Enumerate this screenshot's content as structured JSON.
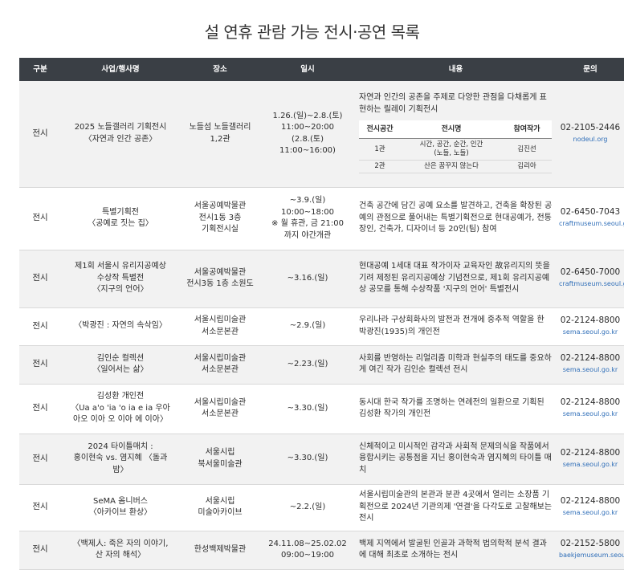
{
  "title": "설 연휴 관람 가능 전시·공연 목록",
  "headers": [
    "구분",
    "사업/행사명",
    "장소",
    "일시",
    "내용",
    "문의"
  ],
  "rows": [
    {
      "type": "전시",
      "name": [
        "2025 노들갤러리 기획전시",
        "〈자연과 인간 공존〉"
      ],
      "place": [
        "노들섬 노들갤러리",
        "1,2관"
      ],
      "date": [
        "1.26.(일)~2.8.(토)",
        "11:00~20:00",
        "(2.8.(토) 11:00~16:00)"
      ],
      "desc": "자연과 인간의 공존을 주제로 다양한 관점을 다채롭게 표현하는 릴레이 기획전시",
      "phone": "02-2105-2446",
      "site": "nodeul.org"
    },
    {
      "type": "전시",
      "name": [
        "특별기획전",
        "〈공예로 짓는 집〉"
      ],
      "place": [
        "서울공예박물관",
        "전시1동 3층",
        "기획전시실"
      ],
      "date": [
        "~3.9.(일)",
        "10:00~18:00",
        "※ 월 휴관, 금 21:00",
        "까지 야간개관"
      ],
      "desc": "건축 공간에 담긴 공예 요소를 발견하고, 건축을 확장된 공예의 관점으로 풀어내는 특별기획전으로 현대공예가, 전통 장인, 건축가, 디자이너 등 20인(팀) 참여",
      "phone": "02-6450-7043",
      "site": "craftmuseum.seoul.go.kr"
    },
    {
      "type": "전시",
      "name": [
        "제1회 서울시 유리지공예상",
        "수상작 특별전",
        "〈지구의 언어〉"
      ],
      "place": [
        "서울공예박물관",
        "전시3동 1층 소원도"
      ],
      "date": [
        "~3.16.(일)"
      ],
      "desc": "현대공예 1세대 대표 작가이자 교육자인 故유리지의 뜻을 기려 제정된 유리지공예상 기념전으로, 제1회 유리지공예상 공모를 통해 수상작품 '지구의 언어' 특별전시",
      "phone": "02-6450-7000",
      "site": "craftmuseum.seoul.go.kr"
    },
    {
      "type": "전시",
      "name": [
        "〈박광진 : 자연의 속삭임〉"
      ],
      "place": [
        "서울시립미술관",
        "서소문본관"
      ],
      "date": [
        "~2.9.(일)"
      ],
      "desc": "우리나라 구상회화사의 발전과 전개에 중추적 역할을 한 박광진(1935)의 개인전",
      "phone": "02-2124-8800",
      "site": "sema.seoul.go.kr"
    },
    {
      "type": "전시",
      "name": [
        "김인순 컬렉션",
        "〈일어서는 삶〉"
      ],
      "place": [
        "서울시립미술관",
        "서소문본관"
      ],
      "date": [
        "~2.23.(일)"
      ],
      "desc": "사회를 반영하는 리얼리즘 미학과 현실주의 태도를 중요하게 여긴 작가 김인순 컬렉션 전시",
      "phone": "02-2124-8800",
      "site": "sema.seoul.go.kr"
    },
    {
      "type": "전시",
      "name": [
        "김성환 개인전",
        "〈Ua a'o 'ia 'o ia e ia 우아",
        "아오 이아 오 이아 에 이아〉"
      ],
      "place": [
        "서울시립미술관",
        "서소문본관"
      ],
      "date": [
        "~3.30.(일)"
      ],
      "desc": "동시대 한국 작가를 조명하는 연례전의 일환으로 기획된 김성환 작가의 개인전",
      "phone": "02-2124-8800",
      "site": "sema.seoul.go.kr"
    },
    {
      "type": "전시",
      "name": [
        "2024 타이틀매치 :",
        "홍이현숙 vs. 염지혜 〈돌과",
        "밤〉"
      ],
      "place": [
        "서울시립",
        "북서울미술관"
      ],
      "date": [
        "~3.30.(일)"
      ],
      "desc": "신체적이고 미시적인 감각과 사회적 문제의식을 작품에서 융합시키는 공통점을 지닌 홍이현숙과 염지혜의 타이틀 매치",
      "phone": "02-2124-8800",
      "site": "sema.seoul.go.kr"
    },
    {
      "type": "전시",
      "name": [
        "SeMA 옴니버스",
        "〈아카이브 환상〉"
      ],
      "place": [
        "서울시립",
        "미술아카이브"
      ],
      "date": [
        "~2.2.(일)"
      ],
      "desc": "서울시립미술관의 본관과 분관 4곳에서 열리는 소장품 기획전으로 2024년 기관의제 '연결'을 다각도로 고찰해보는 전시",
      "phone": "02-2124-8800",
      "site": "sema.seoul.go.kr"
    },
    {
      "type": "전시",
      "name": [
        "〈백제人: 죽은 자의 이야기,",
        "산 자의 해석〉"
      ],
      "place": [
        "한성백제박물관"
      ],
      "date": [
        "24.11.08~25.02.02",
        "09:00~19:00"
      ],
      "desc": "백제 지역에서 발굴된 인골과 과학적 법의학적 분석 결과에 대해 최초로 소개하는 전시",
      "phone": "02-2152-5800",
      "site": "baekjemuseum.seoul.go.kr"
    }
  ],
  "subtable": {
    "headers": [
      "전시공간",
      "전시명",
      "참여작가"
    ],
    "rows": [
      {
        "space": "1관",
        "title": [
          "시간, 공간, 순간, 인간",
          "(노들, 노들)"
        ],
        "artist": "김진선"
      },
      {
        "space": "2관",
        "title": [
          "산은 꿈꾸지 않는다"
        ],
        "artist": "김리아"
      }
    ]
  }
}
